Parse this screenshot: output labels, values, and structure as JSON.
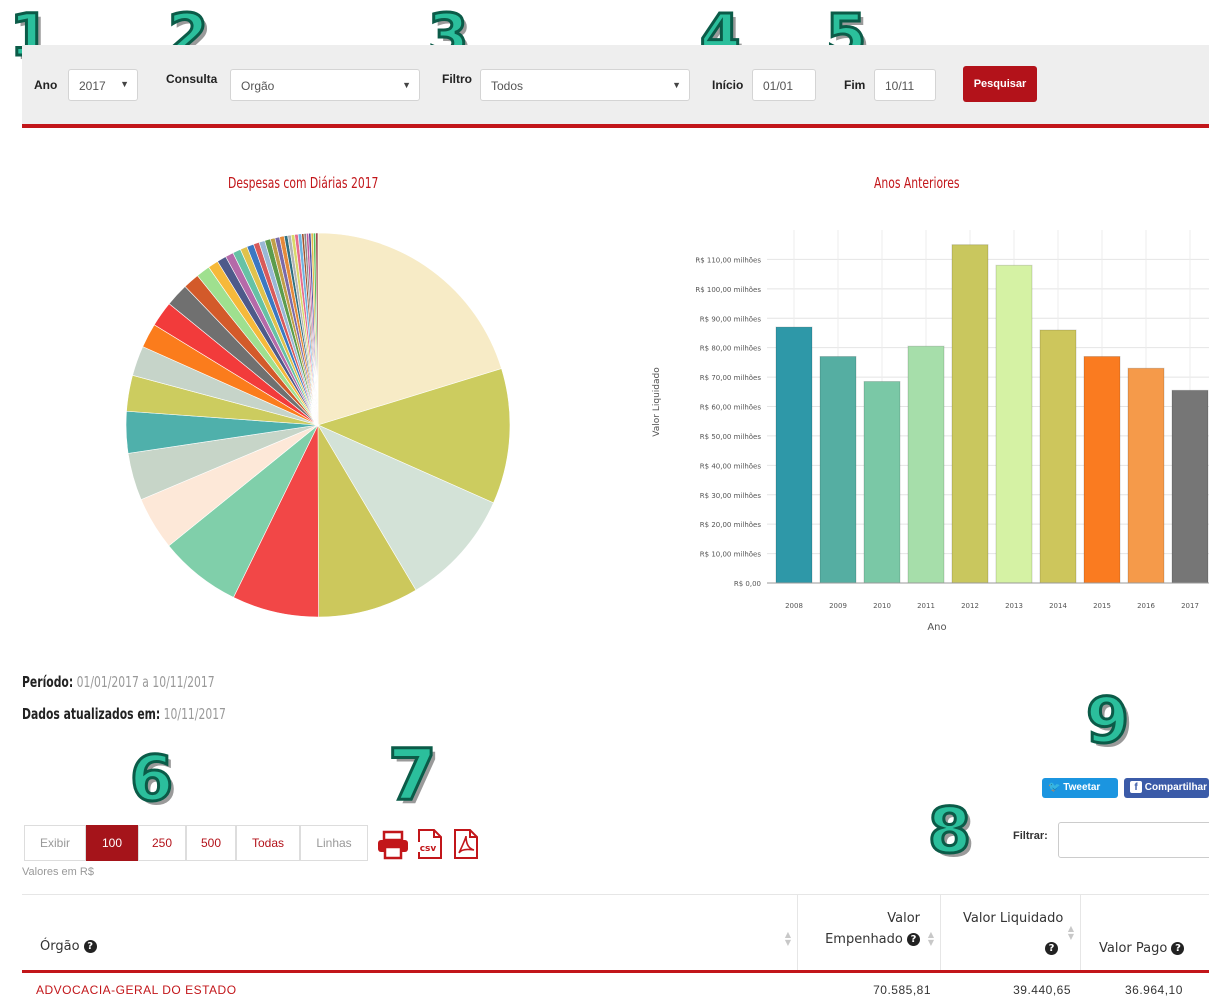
{
  "annotations": [
    "1",
    "2",
    "3",
    "4",
    "5",
    "6",
    "7",
    "8",
    "9"
  ],
  "filters": {
    "ano_label": "Ano",
    "ano_value": "2017",
    "consulta_label": "Consulta",
    "consulta_value": "Orgão",
    "filtro_label": "Filtro",
    "filtro_value": "Todos",
    "inicio_label": "Início",
    "inicio_value": "01/01",
    "fim_label": "Fim",
    "fim_value": "10/11",
    "search_label": "Pesquisar"
  },
  "pie_chart": {
    "title": "Despesas com Diárias 2017"
  },
  "chart_data": [
    {
      "type": "pie",
      "title": "Despesas com Diárias 2017",
      "values": [
        20.8,
        11.7,
        10.1,
        8.7,
        7.5,
        7.1,
        4.6,
        4.1,
        3.6,
        3.1,
        2.6,
        2.1,
        2.2,
        2.0,
        1.4,
        1.2,
        0.9,
        0.8,
        0.7,
        0.7,
        0.6,
        0.6,
        0.5,
        0.5,
        0.5,
        0.4,
        0.4,
        0.4,
        0.3,
        0.3,
        0.3,
        0.3,
        0.3,
        0.2,
        0.2,
        0.2,
        0.2,
        0.2,
        0.2,
        0.2
      ],
      "colors": [
        "#f7ebc6",
        "#cccc5f",
        "#d3e2d7",
        "#ccc85c",
        "#f24747",
        "#80cfaa",
        "#fde8d8",
        "#c7d5c8",
        "#4fb0ab",
        "#cccc5f",
        "#c6d4c9",
        "#fb7c1c",
        "#f23b3b",
        "#707070",
        "#d35a2a",
        "#9fe08f",
        "#f6b93a",
        "#4e5a8a",
        "#b56aa9",
        "#66c2a5",
        "#e0c24c",
        "#3a78c2",
        "#d85a5a",
        "#9ab8d6",
        "#5c9c4c",
        "#c29f48",
        "#7a6aa8",
        "#e58a3a",
        "#2f6f7f",
        "#b3b3b3",
        "#d9d96a",
        "#e66c8c",
        "#6fb3e0",
        "#a0522d",
        "#888888",
        "#c25c9c",
        "#4c4c9c",
        "#e6b84c",
        "#5ac25a",
        "#9c4c4c"
      ]
    },
    {
      "type": "bar",
      "title": "Anos Anteriores",
      "xlabel": "Ano",
      "ylabel": "Valor Liquidado",
      "categories": [
        "2008",
        "2009",
        "2010",
        "2011",
        "2012",
        "2013",
        "2014",
        "2015",
        "2016",
        "2017"
      ],
      "values": [
        87,
        77,
        68.5,
        80.5,
        115,
        108,
        86,
        77,
        73,
        65.5
      ],
      "colors": [
        "#2e98a8",
        "#55aea2",
        "#7ac8a6",
        "#a6deaa",
        "#c9c75e",
        "#d5f2a4",
        "#cdc65c",
        "#fa7b20",
        "#f59a4a",
        "#767676"
      ],
      "ylim": [
        0,
        120
      ],
      "yticks": [
        {
          "value": 0,
          "label": "R$ 0,00"
        },
        {
          "value": 10,
          "label": "R$ 10,00 milhões"
        },
        {
          "value": 20,
          "label": "R$ 20,00 milhões"
        },
        {
          "value": 30,
          "label": "R$ 30,00 milhões"
        },
        {
          "value": 40,
          "label": "R$ 40,00 milhões"
        },
        {
          "value": 50,
          "label": "R$ 50,00 milhões"
        },
        {
          "value": 60,
          "label": "R$ 60,00 milhões"
        },
        {
          "value": 70,
          "label": "R$ 70,00 milhões"
        },
        {
          "value": 80,
          "label": "R$ 80,00 milhões"
        },
        {
          "value": 90,
          "label": "R$ 90,00 milhões"
        },
        {
          "value": 100,
          "label": "R$ 100,00 milhões"
        },
        {
          "value": 110,
          "label": "R$ 110,00 milhões"
        }
      ],
      "grid": true
    }
  ],
  "bar_chart": {
    "title": "Anos Anteriores",
    "xlabel": "Ano",
    "ylabel": "Valor Liquidado"
  },
  "info": {
    "periodo_label": "Período:",
    "periodo_value": "01/01/2017 a 10/11/2017",
    "atualizado_label": "Dados atualizados em:",
    "atualizado_value": "10/11/2017"
  },
  "pagination": {
    "exibir": "Exibir",
    "opt_100": "100",
    "opt_250": "250",
    "opt_500": "500",
    "opt_todas": "Todas",
    "linhas": "Linhas",
    "active": "100"
  },
  "values_note": "Valores em R$",
  "social": {
    "tweet": "Tweetar",
    "share": "Compartilhar"
  },
  "table_filter_label": "Filtrar:",
  "table": {
    "headers": [
      "Órgão",
      "Valor Empenhado",
      "Valor Liquidado",
      "Valor Pago"
    ],
    "header_lines": {
      "valor_line1": "Valor",
      "empenhado_line2": "Empenhado",
      "liquidado_line1": "Valor Liquidado",
      "pago_line1": "Valor Pago"
    },
    "rows": [
      {
        "orgao": "ADVOCACIA-GERAL DO ESTADO",
        "empenhado": "70.585,81",
        "liquidado": "39.440,65",
        "pago": "36.964,10"
      }
    ]
  }
}
